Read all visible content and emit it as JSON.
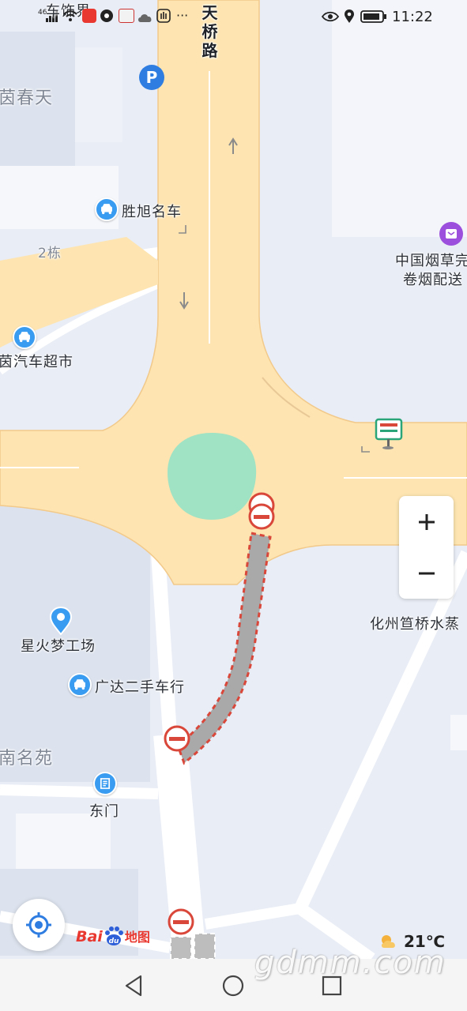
{
  "status_bar": {
    "time": "11:22",
    "signal_label": "46",
    "notification_text": "车饰界",
    "more_icons": "···"
  },
  "map": {
    "road_name": "天桥路",
    "labels": {
      "top_left_area": "茵春天",
      "building_2": "2栋",
      "south_area": "南名苑",
      "china_tobacco_line1": "中国烟草完",
      "china_tobacco_line2": "卷烟配送",
      "huazhou": "化州笪桥水蒸"
    },
    "pois": [
      {
        "name": "胜旭名车",
        "icon": "car-icon"
      },
      {
        "name": "茵汽车超市",
        "icon": "car-icon"
      },
      {
        "name": "星火梦工场",
        "icon": "map-pin-icon"
      },
      {
        "name": "广达二手车行",
        "icon": "car-icon"
      },
      {
        "name": "东门",
        "icon": "gate-icon"
      }
    ],
    "colors": {
      "road_major": "#fde4b0",
      "road_minor": "#ffffff",
      "roundabout": "#9fe2c4",
      "blocked_route": "#a9a9a9",
      "blocked_outline": "#d9473a",
      "poi_blue": "#3a9cf0",
      "poi_purple": "#9b4fdc"
    }
  },
  "controls": {
    "zoom_in": "+",
    "zoom_out": "−"
  },
  "brand": {
    "bai": "Bai",
    "du": "du",
    "ditu": "地图"
  },
  "weather": {
    "temperature": "21℃",
    "icon": "partly-cloudy-icon"
  },
  "watermark": "gdmm.com"
}
